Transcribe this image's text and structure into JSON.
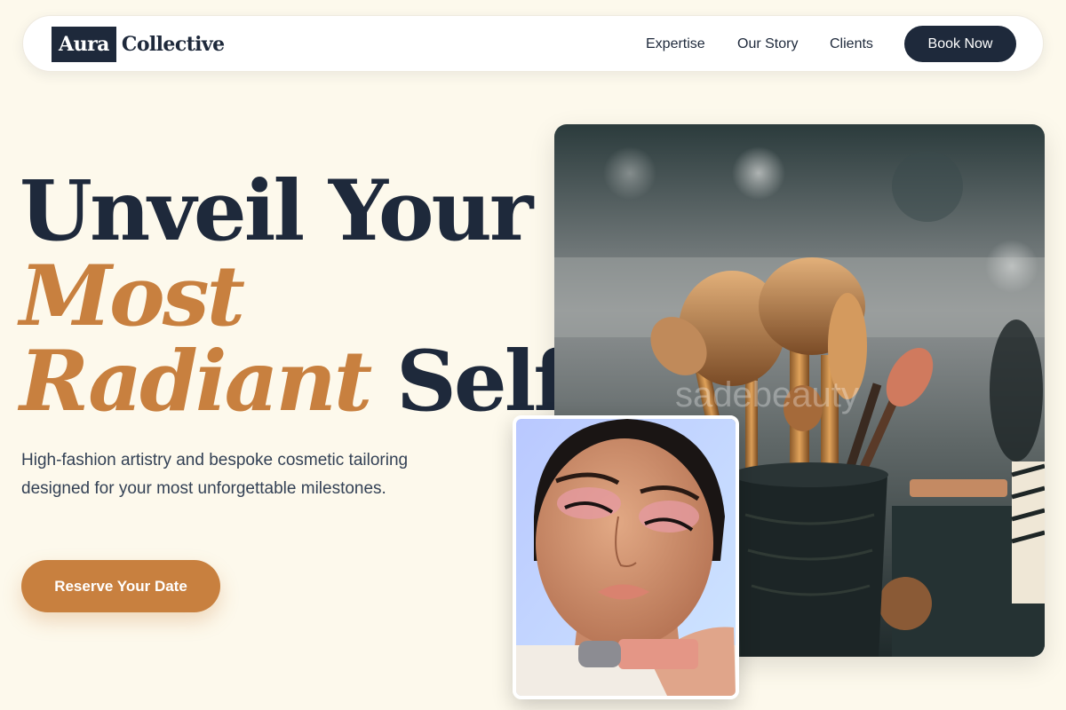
{
  "brand": {
    "logo_box": "Aura",
    "logo_text": "Collective"
  },
  "nav": {
    "links": [
      "Expertise",
      "Our Story",
      "Clients"
    ],
    "cta": "Book Now"
  },
  "hero": {
    "headline_line1": "Unveil Your",
    "headline_accent1": "Most",
    "headline_accent2": "Radiant",
    "headline_end": " Self.",
    "subtext": "High-fashion artistry and bespoke cosmetic tailoring designed for your most unforgettable milestones.",
    "cta": "Reserve Your Date"
  },
  "images": {
    "main": {
      "subject": "makeup brushes in a dark cup",
      "watermark": "sadebeauty"
    },
    "inset": {
      "subject": "model with rosy eye makeup holding a blush product"
    }
  },
  "colors": {
    "navy": "#1e293b",
    "accent": "#c8803f",
    "background": "#fdf9ec"
  }
}
